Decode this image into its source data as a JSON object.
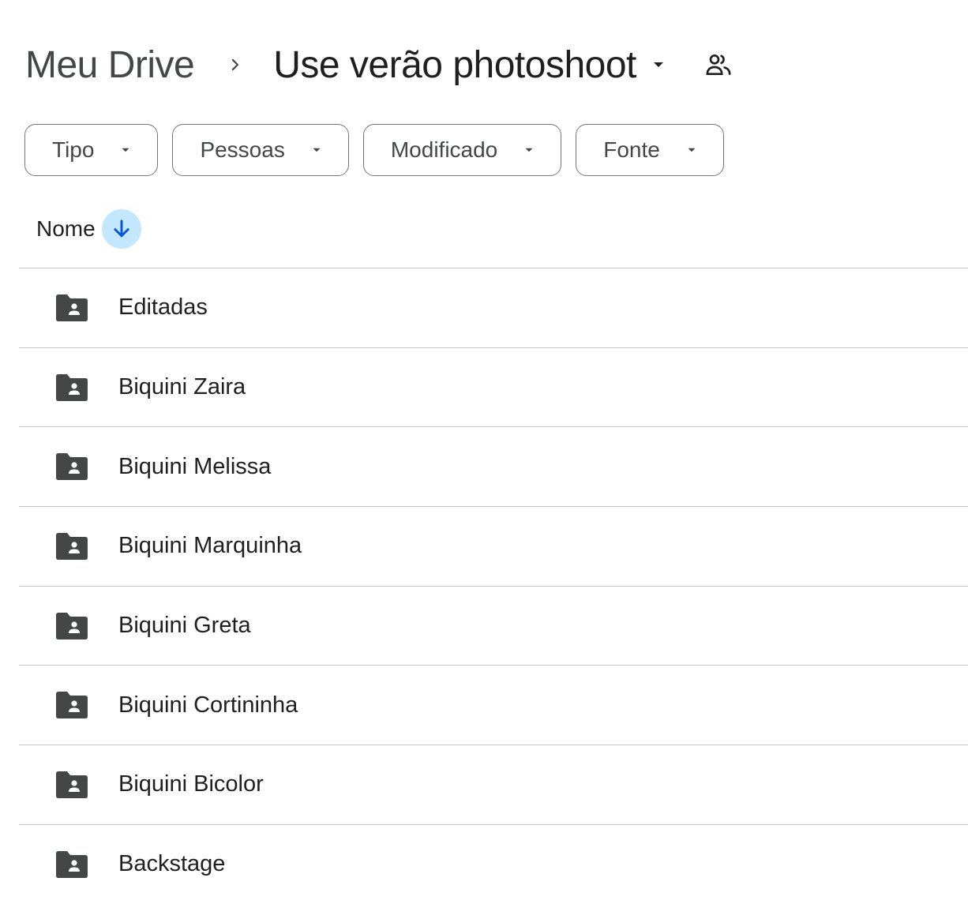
{
  "breadcrumb": {
    "root": "Meu Drive",
    "separator_icon": "chevron-right-icon",
    "current": "Use verão photoshoot",
    "current_caret_icon": "arrow-drop-down-icon",
    "shared_icon": "people-icon"
  },
  "filters": [
    {
      "label": "Tipo",
      "icon": "arrow-drop-down-icon"
    },
    {
      "label": "Pessoas",
      "icon": "arrow-drop-down-icon"
    },
    {
      "label": "Modificado",
      "icon": "arrow-drop-down-icon"
    },
    {
      "label": "Fonte",
      "icon": "arrow-drop-down-icon"
    }
  ],
  "sort": {
    "label": "Nome",
    "direction_icon": "arrow-down-icon",
    "accent_bg": "#c2e7ff",
    "accent_fg": "#0b57d0"
  },
  "files": [
    {
      "name": "Editadas",
      "icon": "shared-folder-icon"
    },
    {
      "name": "Biquini Zaira",
      "icon": "shared-folder-icon"
    },
    {
      "name": "Biquini Melissa",
      "icon": "shared-folder-icon"
    },
    {
      "name": "Biquini Marquinha",
      "icon": "shared-folder-icon"
    },
    {
      "name": "Biquini Greta",
      "icon": "shared-folder-icon"
    },
    {
      "name": "Biquini Cortininha",
      "icon": "shared-folder-icon"
    },
    {
      "name": "Biquini Bicolor",
      "icon": "shared-folder-icon"
    },
    {
      "name": "Backstage",
      "icon": "shared-folder-icon"
    }
  ]
}
